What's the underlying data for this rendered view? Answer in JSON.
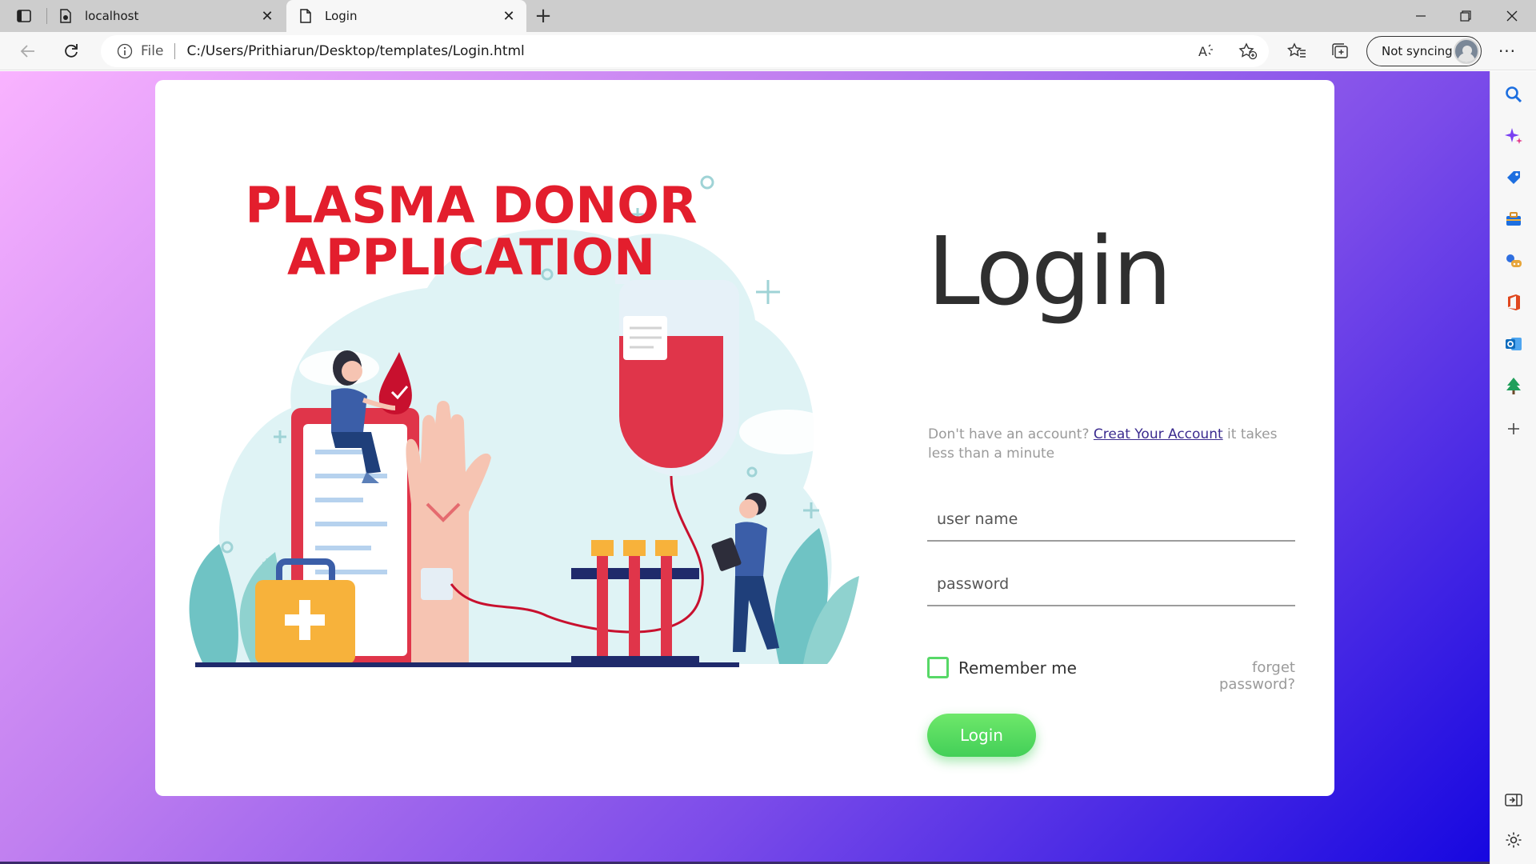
{
  "browser": {
    "tabs": [
      {
        "title": "localhost",
        "icon": "page-lock-icon"
      },
      {
        "title": "Login",
        "icon": "page-icon",
        "active": true
      }
    ],
    "address": {
      "scheme": "File",
      "url": "C:/Users/Prithiarun/Desktop/templates/Login.html"
    },
    "profile_label": "Not syncing"
  },
  "illustration": {
    "heading_line1": "PLASMA DONOR",
    "heading_line2": "APPLICATION"
  },
  "login": {
    "title": "Login",
    "signup_prefix": "Don't have an account? ",
    "signup_link": "Creat Your Account",
    "signup_suffix": " it takes less than a minute",
    "username_placeholder": "user name",
    "password_placeholder": "password",
    "remember_label": "Remember me",
    "forgot_label": "forget password?",
    "button_label": "Login"
  },
  "colors": {
    "background_gradient": [
      "#f9b3ff",
      "#7b4be9",
      "#1607e0"
    ],
    "accent_green": "#43cf58",
    "heading_red": "#e31e2d"
  }
}
